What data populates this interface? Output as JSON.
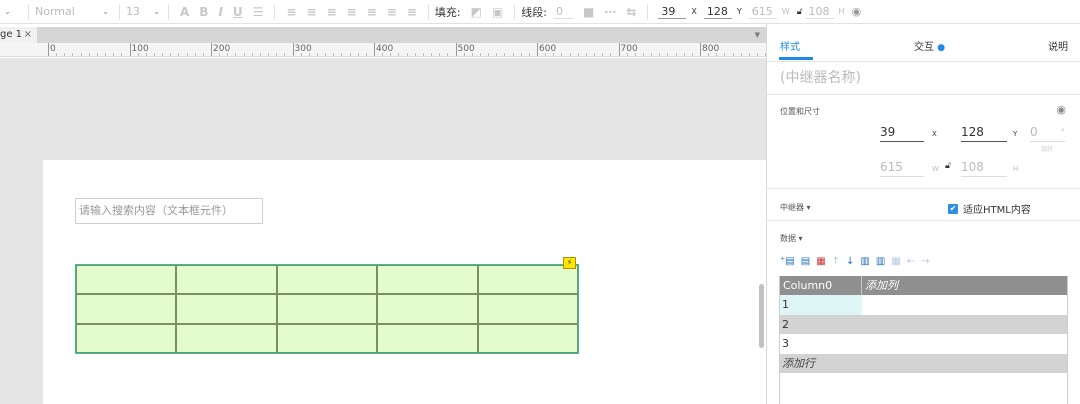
{
  "toolbar": {
    "font_style": "Normal",
    "font_size": "13",
    "fill_label": "填充:",
    "stroke_label": "线段:",
    "stroke_value": "0",
    "x": "39",
    "x_unit": "X",
    "y": "128",
    "y_unit": "Y",
    "w": "615",
    "w_unit": "W",
    "h": "108",
    "h_unit": "H"
  },
  "page_tab": {
    "label": "ge 1",
    "close": "×"
  },
  "ruler": {
    "labels": [
      "0",
      "100",
      "200",
      "300",
      "400",
      "500",
      "600",
      "700",
      "800"
    ]
  },
  "canvas": {
    "search_placeholder": "请输入搜索内容（文本框元件）",
    "repeater_badge": "⚡"
  },
  "panel": {
    "tabs": [
      "样式",
      "交互",
      "说明"
    ],
    "active_tab": "样式",
    "interaction_dot": "●",
    "widget_name": "(中继器名称)",
    "position_section": "位置和尺寸",
    "x": "39",
    "x_unit": "X",
    "y": "128",
    "y_unit": "Y",
    "rotation": "0",
    "rotation_unit": "°",
    "rotation_label": "旋转",
    "w": "615",
    "w_unit": "W",
    "h": "108",
    "h_unit": "H",
    "repeater_section": "中继器 ▾",
    "fit_html_label": "适应HTML内容",
    "fit_html_checked": true,
    "data_section": "数据 ▾",
    "grid": {
      "column_header": "Column0",
      "add_column": "添加列",
      "rows": [
        "1",
        "2",
        "3"
      ],
      "add_row": "添加行"
    }
  },
  "colors": {
    "accent": "#1a8be8",
    "repeater_fill": "#e4fccc",
    "repeater_border": "#2fc39c",
    "grid_header": "#8f8f8f"
  }
}
